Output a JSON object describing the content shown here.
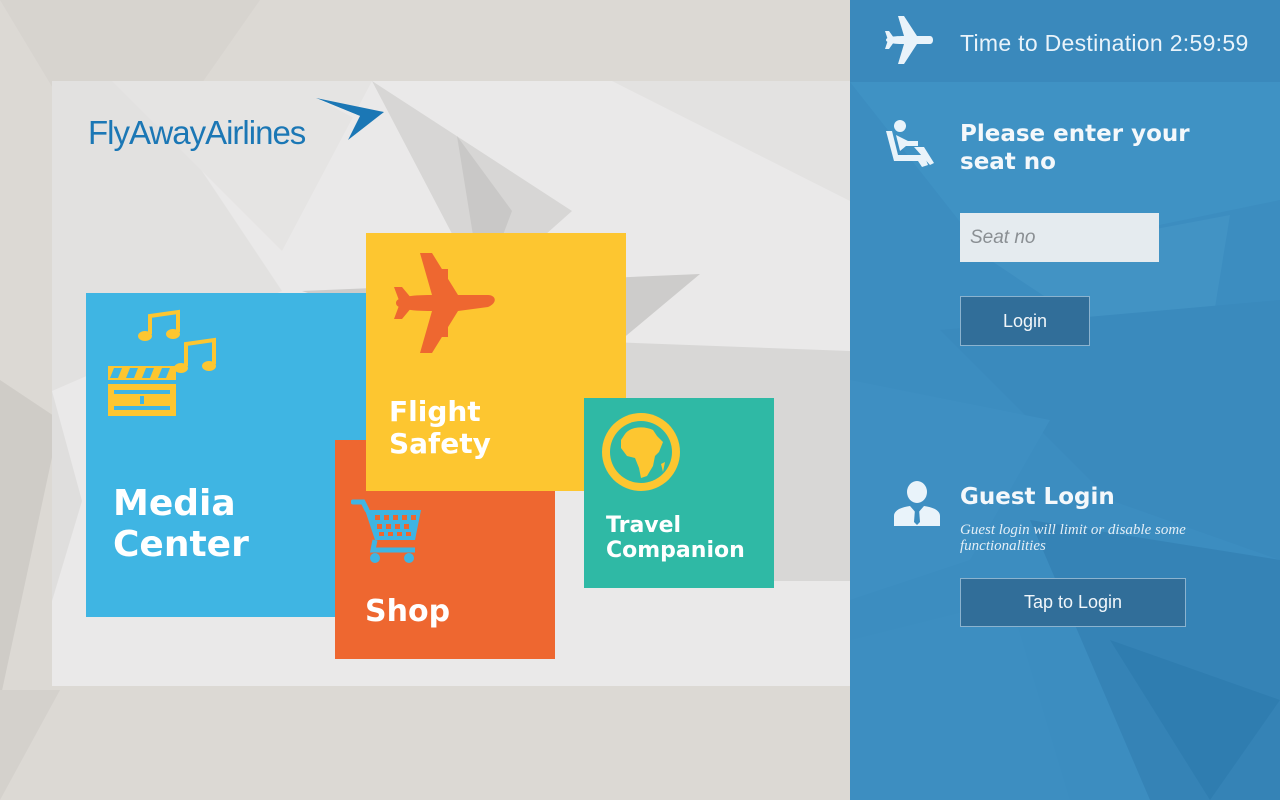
{
  "brand": {
    "name_bold": "FlyAway",
    "name_light": "Airlines",
    "color": "#1b77b5"
  },
  "tiles": [
    {
      "id": "media",
      "label_line1": "Media",
      "label_line2": "Center",
      "color": "#3fb5e3",
      "icon": "clapperboard-music-icon"
    },
    {
      "id": "flight",
      "label_line1": "Flight",
      "label_line2": "Safety",
      "color": "#fdc630",
      "icon": "airplane-icon"
    },
    {
      "id": "shop",
      "label_line1": "Shop",
      "color": "#ee6730",
      "icon": "shopping-cart-icon"
    },
    {
      "id": "travel",
      "label_line1": "Travel",
      "label_line2": "Companion",
      "color": "#2fb9a5",
      "icon": "globe-africa-icon"
    }
  ],
  "sidebar": {
    "timer": {
      "label": "Time to Destination",
      "value": "2:59:59",
      "icon": "airplane-icon"
    },
    "seat": {
      "title": "Please enter your seat no",
      "placeholder": "Seat no",
      "login_label": "Login",
      "icon": "passenger-seat-icon"
    },
    "guest": {
      "title": "Guest Login",
      "note": "Guest login will limit or disable some functionalities",
      "button_label": "Tap to Login",
      "icon": "user-icon"
    },
    "color": "#3c8dc0"
  }
}
